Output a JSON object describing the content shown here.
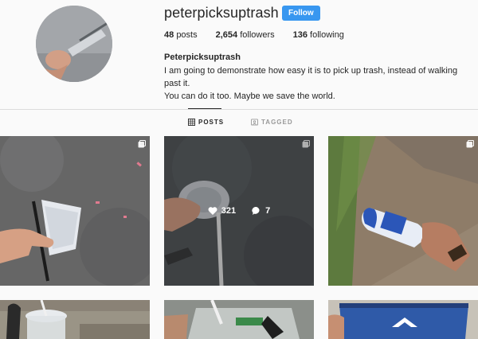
{
  "profile": {
    "username": "peterpicksuptrash",
    "follow_label": "Follow",
    "posts_count": "48",
    "posts_label": "posts",
    "followers_count": "2,654",
    "followers_label": "followers",
    "following_count": "136",
    "following_label": "following",
    "full_name": "Peterpicksuptrash",
    "bio_line1": "I am going to demonstrate how easy it is to pick up trash, instead of walking past it.",
    "bio_line2": "You can do it too. Maybe we save the world."
  },
  "tabs": {
    "posts_label": "POSTS",
    "tagged_label": "TAGGED",
    "active": "posts"
  },
  "hover_post": {
    "likes": "321",
    "comments": "7"
  },
  "icons": {
    "tab_posts": "grid-icon",
    "tab_tagged": "tag-icon",
    "multi_post": "carousel-icon",
    "likes": "heart-icon",
    "comments": "comment-icon"
  },
  "colors": {
    "follow_button": "#3897f0",
    "background": "#fafafa",
    "divider": "#dbdbdb"
  }
}
